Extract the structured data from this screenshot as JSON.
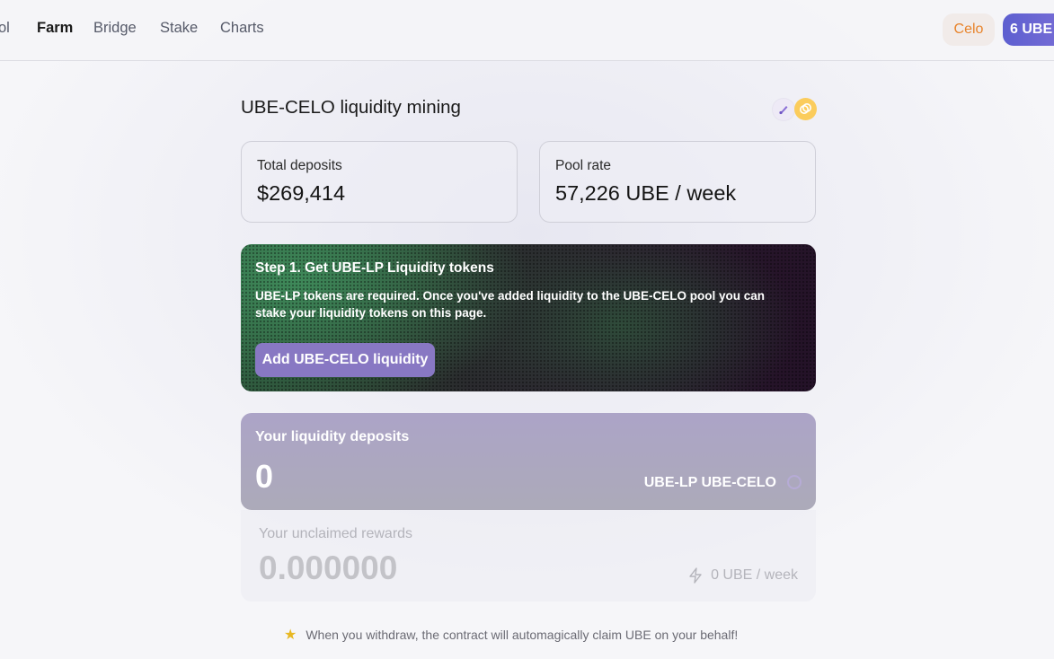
{
  "nav": {
    "items": [
      {
        "label": "ol",
        "active": false
      },
      {
        "label": "Farm",
        "active": true
      },
      {
        "label": "Bridge",
        "active": false
      },
      {
        "label": "Stake",
        "active": false
      },
      {
        "label": "Charts",
        "active": false
      }
    ],
    "network_label": "Celo",
    "ube_balance_label": "6 UBE"
  },
  "page": {
    "title": "UBE-CELO liquidity mining",
    "token_icons": [
      "ube-token-icon",
      "celo-token-icon"
    ]
  },
  "stats": {
    "total_deposits_label": "Total deposits",
    "total_deposits_value": "$269,414",
    "pool_rate_label": "Pool rate",
    "pool_rate_value": "57,226 UBE / week"
  },
  "banner": {
    "title": "Step 1. Get UBE-LP Liquidity tokens",
    "text": "UBE-LP tokens are required. Once you've added liquidity to the UBE-CELO pool you can stake your liquidity tokens on this page.",
    "button_label": "Add UBE-CELO liquidity"
  },
  "deposits": {
    "title": "Your liquidity deposits",
    "value": "0",
    "unit": "UBE-LP UBE-CELO"
  },
  "rewards": {
    "label": "Your unclaimed rewards",
    "value": "0.000000",
    "rate": "0 UBE / week"
  },
  "note": {
    "icon": "star",
    "text": "When you withdraw, the contract will automagically claim UBE on your behalf!"
  },
  "colors": {
    "accent": "#8878c3",
    "celo": "#e8832a",
    "ube_pill": "#5d5fd0"
  }
}
